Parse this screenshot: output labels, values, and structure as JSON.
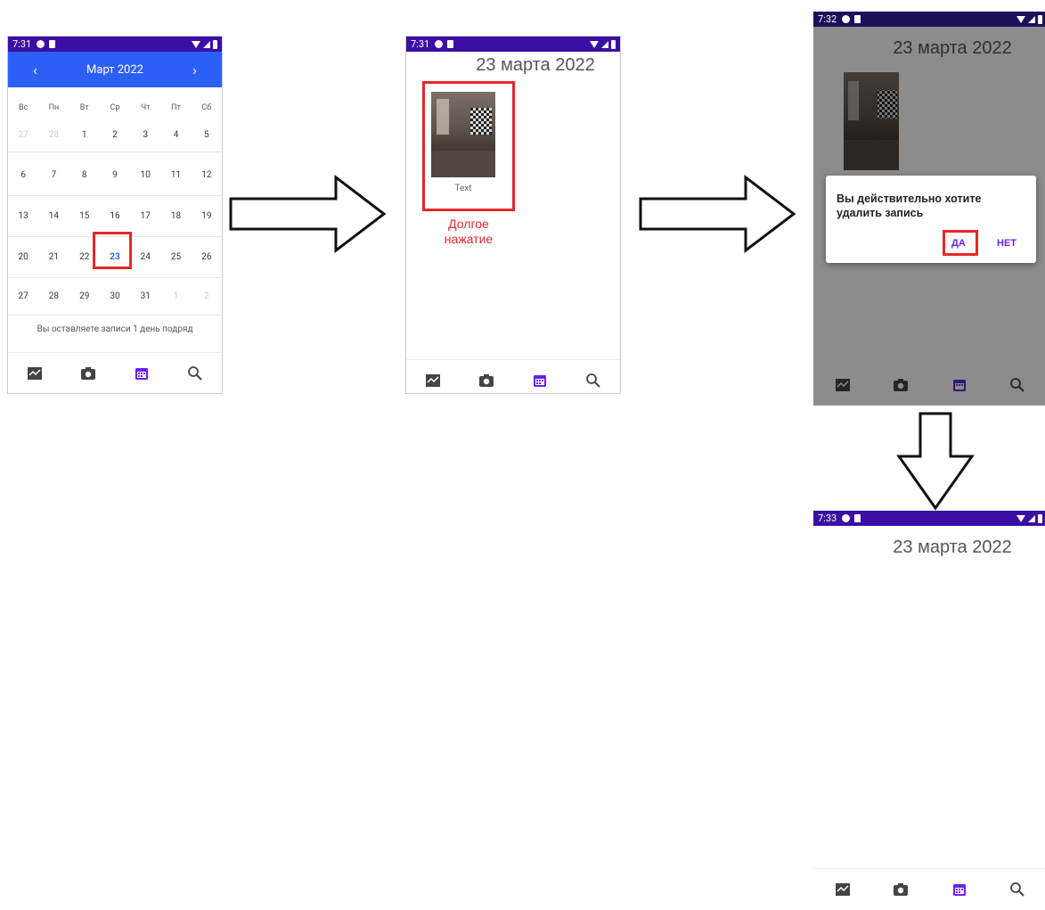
{
  "screen1": {
    "status_time": "7:31",
    "month_label": "Март 2022",
    "prev_icon": "chevron-left-icon",
    "next_icon": "chevron-right-icon",
    "weekdays": [
      "Вс",
      "Пн",
      "Вт",
      "Ср",
      "Чт",
      "Пт",
      "Сб"
    ],
    "weeks": [
      [
        "27",
        "28",
        "1",
        "2",
        "3",
        "4",
        "5"
      ],
      [
        "6",
        "7",
        "8",
        "9",
        "10",
        "11",
        "12"
      ],
      [
        "13",
        "14",
        "15",
        "16",
        "17",
        "18",
        "19"
      ],
      [
        "20",
        "21",
        "22",
        "23",
        "24",
        "25",
        "26"
      ],
      [
        "27",
        "28",
        "29",
        "30",
        "31",
        "1",
        "2"
      ]
    ],
    "selected_day": "23",
    "streak_text": "Вы оставляете записи 1 день подряд"
  },
  "screen2": {
    "status_time": "7:31",
    "date_title": "23 марта 2022",
    "entry_caption": "Text",
    "annotation": "Долгое нажатие"
  },
  "screen3": {
    "status_time": "7:32",
    "date_title": "23 марта 2022",
    "dialog_message": "Вы действительно хотите удалить запись",
    "yes_label": "ДА",
    "no_label": "НЕТ"
  },
  "screen4": {
    "status_time": "7:33",
    "date_title": "23 марта 2022"
  },
  "nav_icons": [
    "chart-icon",
    "camera-icon",
    "calendar-icon",
    "search-icon"
  ],
  "colors": {
    "status_bar": "#3a0fa3",
    "calendar_header": "#2c5ff6",
    "highlight": "#e8262b",
    "accent": "#6a1ff0"
  }
}
